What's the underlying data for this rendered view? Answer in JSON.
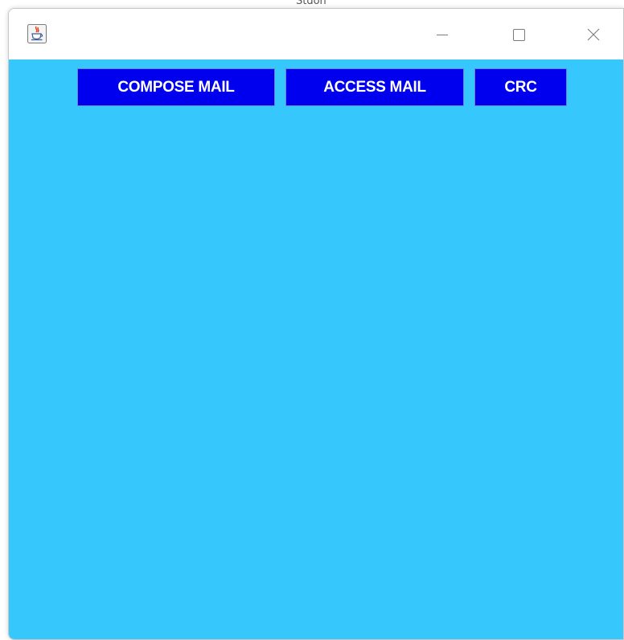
{
  "background_text": "Stdon",
  "window": {
    "icon": "java-coffee-cup-icon",
    "controls": {
      "minimize": "minimize-icon",
      "maximize": "maximize-icon",
      "close": "close-icon"
    }
  },
  "toolbar": {
    "compose_label": "COMPOSE MAIL",
    "access_label": "ACCESS MAIL",
    "crc_label": "CRC"
  },
  "colors": {
    "content_background": "#36c8fc",
    "button_background": "#0000ee",
    "button_text": "#ffffff"
  }
}
